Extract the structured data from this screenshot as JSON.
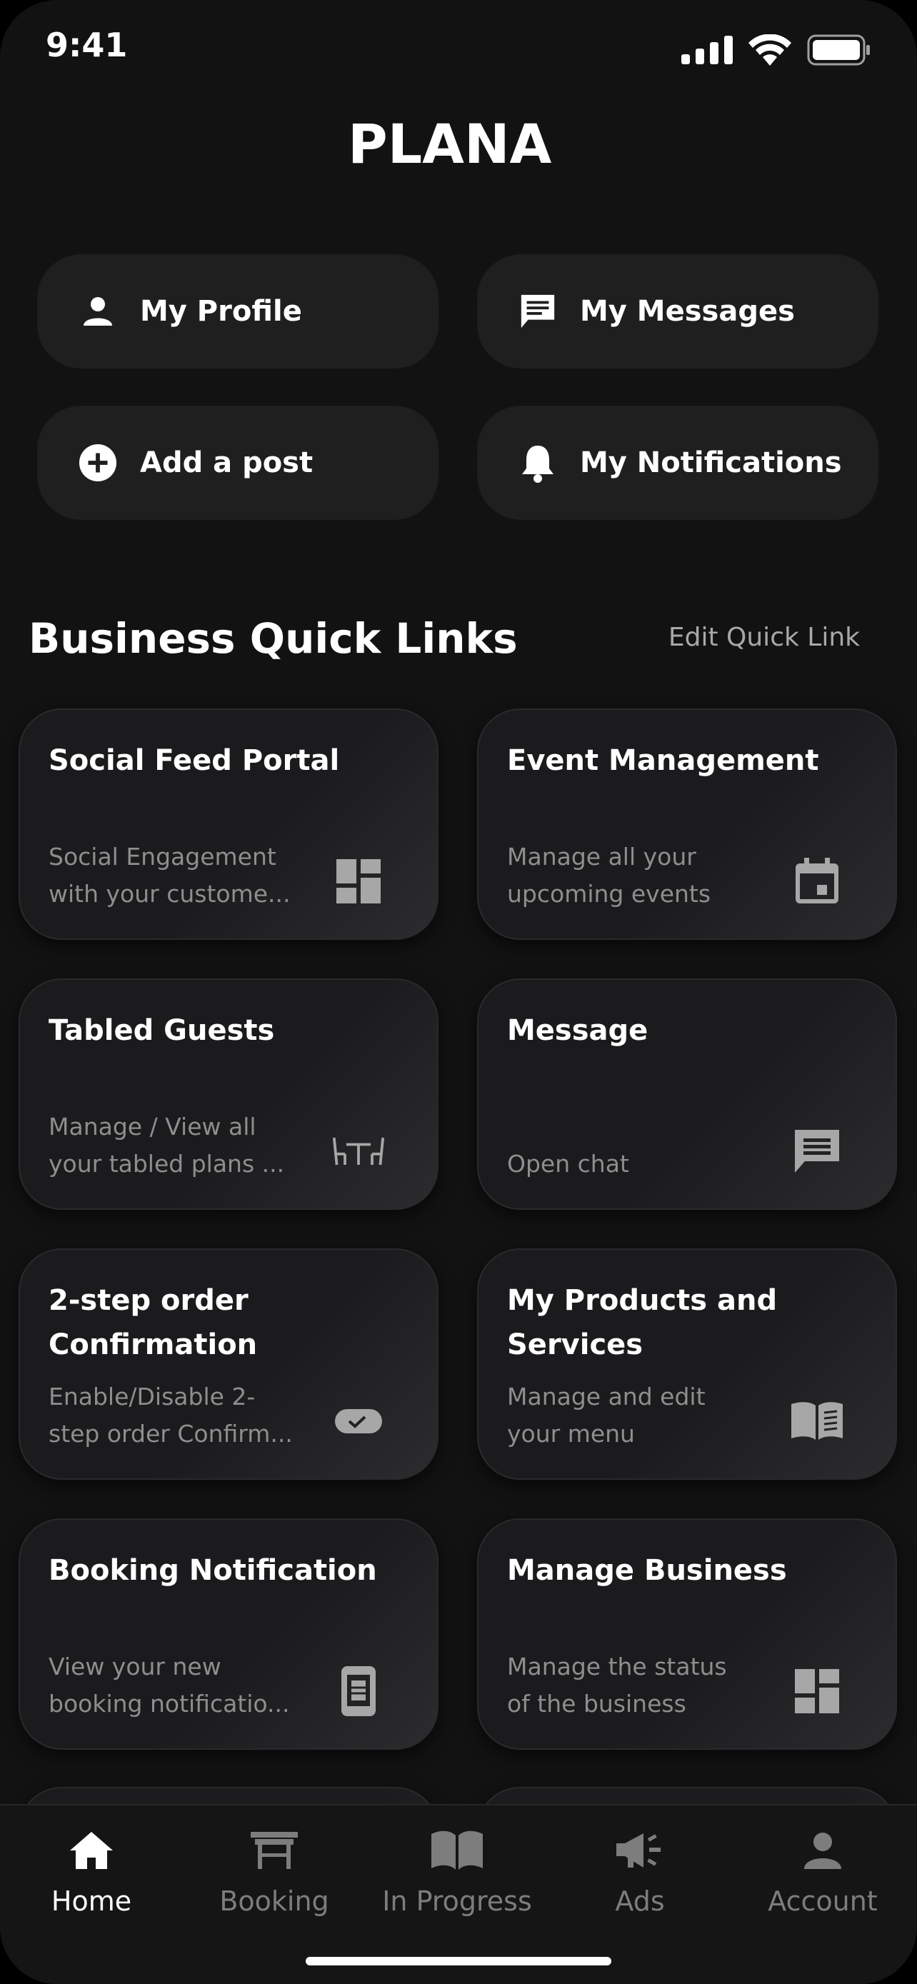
{
  "status": {
    "time": "9:41"
  },
  "brand": {
    "name": "PLANA"
  },
  "quick_actions": [
    {
      "label": "My Profile",
      "icon": "person-icon"
    },
    {
      "label": "My Messages",
      "icon": "message-icon"
    },
    {
      "label": "Add a post",
      "icon": "add-circle-icon"
    },
    {
      "label": "My Notifications",
      "icon": "bell-icon"
    }
  ],
  "section": {
    "title": "Business Quick Links",
    "edit_label": "Edit Quick Link"
  },
  "cards": [
    {
      "title": "Social Feed Portal",
      "desc1": "Social Engagement",
      "desc2": "with your custome...",
      "icon": "dashboard-icon"
    },
    {
      "title": "Event Management",
      "desc1": "Manage all your",
      "desc2": "upcoming events",
      "icon": "calendar-icon"
    },
    {
      "title": "Tabled Guests",
      "desc1": "Manage / View all",
      "desc2": "your tabled plans ...",
      "icon": "table-chairs-icon"
    },
    {
      "title": "Message",
      "desc1": "",
      "desc2": "Open chat",
      "icon": "chat-icon"
    },
    {
      "title": "2-step order Confirmation",
      "desc1": "Enable/Disable 2-",
      "desc2": "step order Confirm...",
      "icon": "toggle-check-icon"
    },
    {
      "title": "My Products and Services",
      "desc1": "Manage and edit",
      "desc2": "your menu",
      "icon": "menu-book-icon"
    },
    {
      "title": "Booking Notification",
      "desc1": "View your new",
      "desc2": "booking notificatio...",
      "icon": "booking-device-icon"
    },
    {
      "title": "Manage Business",
      "desc1": "Manage the status",
      "desc2": "of the business",
      "icon": "dashboard-icon"
    }
  ],
  "tabs": [
    {
      "label": "Home",
      "icon": "home-icon",
      "active": true
    },
    {
      "label": "Booking",
      "icon": "booking-table-icon"
    },
    {
      "label": "In Progress",
      "icon": "open-book-icon"
    },
    {
      "label": "Ads",
      "icon": "megaphone-icon"
    },
    {
      "label": "Account",
      "icon": "account-icon"
    }
  ],
  "colors": {
    "background": "#121212",
    "surface": "#1f1f20",
    "muted_text": "#8e8e8e",
    "icon_muted": "#a7a7a7"
  }
}
